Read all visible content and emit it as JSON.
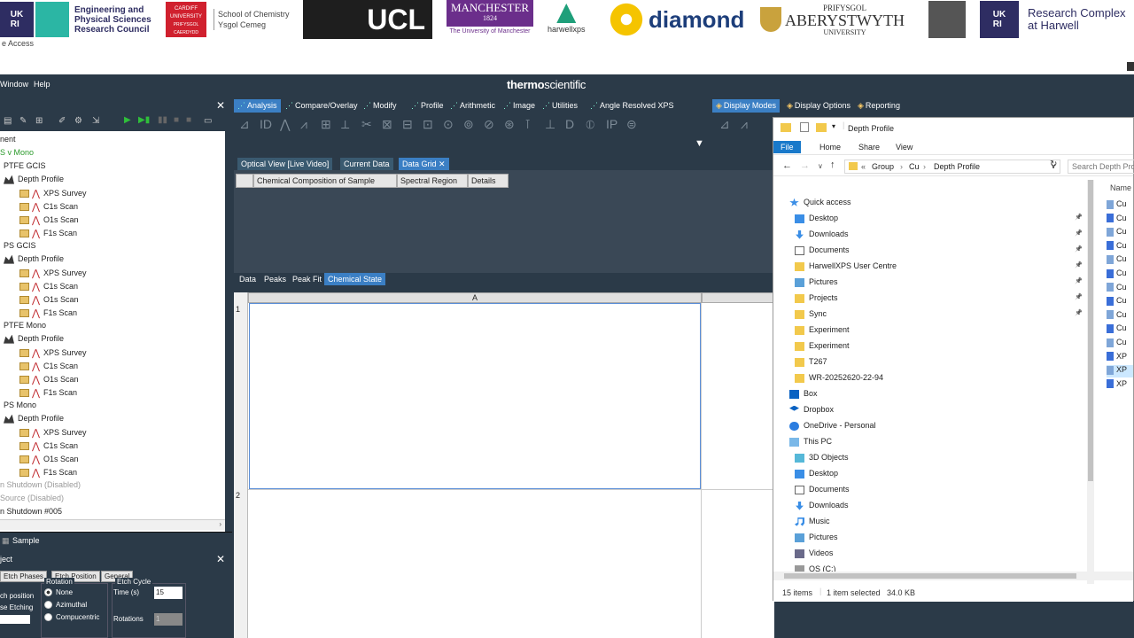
{
  "banner": {
    "epsrc": "Engineering and Physical Sciences Research Council",
    "cardiff_top": "CARDIFF UNIVERSITY",
    "cardiff_bottom": "PRIFYSGOL CAERDYDD",
    "chemistry": "School of Chemistry",
    "chemistry_cy": "Ysgol Cemeg",
    "ucl": "UCL",
    "manchester": "MANCHESTER",
    "manchester_year": "1824",
    "manchester_sub": "The University of Manchester",
    "harwellxps": "harwellxps",
    "diamond": "diamond",
    "aber_top": "PRIFYSGOL",
    "aber_name": "ABERYSTWYTH",
    "aber_bottom": "UNIVERSITY",
    "rch": "Research Complex at Harwell",
    "subtext": "e Access"
  },
  "menubar": {
    "window": "Window",
    "help": "Help"
  },
  "brand": {
    "bold": "thermo",
    "light": "scientific"
  },
  "main_tabs": [
    "Analysis",
    "Compare/Overlay",
    "Modify",
    "Profile",
    "Arithmetic",
    "Image",
    "Utilities",
    "Angle Resolved XPS"
  ],
  "right_tabs": [
    "Display Modes",
    "Display Options",
    "Reporting"
  ],
  "view_tabs": [
    "Optical View [Live Video]",
    "Current Data",
    "Data Grid"
  ],
  "grid_headers": [
    "Chemical Composition of Sample",
    "Spectral Region",
    "Details"
  ],
  "sub_tabs": [
    "Data",
    "Peaks",
    "Peak Fit",
    "Chemical State"
  ],
  "sheet": {
    "col_a": "A",
    "row1": "1",
    "row2": "2"
  },
  "tree": [
    {
      "label": "nent",
      "indent": 0
    },
    {
      "label": "S v Mono",
      "indent": 0,
      "green": true
    },
    {
      "label": "PTFE GCIS",
      "indent": 1
    },
    {
      "label": "Depth Profile",
      "indent": 2,
      "icon": true
    },
    {
      "label": "XPS Survey",
      "indent": 3,
      "scan": true
    },
    {
      "label": "C1s Scan",
      "indent": 3,
      "scan": true
    },
    {
      "label": "O1s Scan",
      "indent": 3,
      "scan": true
    },
    {
      "label": "F1s Scan",
      "indent": 3,
      "scan": true
    },
    {
      "label": "PS GCIS",
      "indent": 1
    },
    {
      "label": "Depth Profile",
      "indent": 2,
      "icon": true
    },
    {
      "label": "XPS Survey",
      "indent": 3,
      "scan": true
    },
    {
      "label": "C1s Scan",
      "indent": 3,
      "scan": true
    },
    {
      "label": "O1s Scan",
      "indent": 3,
      "scan": true
    },
    {
      "label": "F1s Scan",
      "indent": 3,
      "scan": true
    },
    {
      "label": "PTFE Mono",
      "indent": 1
    },
    {
      "label": "Depth Profile",
      "indent": 2,
      "icon": true
    },
    {
      "label": "XPS Survey",
      "indent": 3,
      "scan": true
    },
    {
      "label": "C1s Scan",
      "indent": 3,
      "scan": true
    },
    {
      "label": "O1s Scan",
      "indent": 3,
      "scan": true
    },
    {
      "label": "F1s Scan",
      "indent": 3,
      "scan": true
    },
    {
      "label": "PS Mono",
      "indent": 1
    },
    {
      "label": "Depth Profile",
      "indent": 2,
      "icon": true
    },
    {
      "label": "XPS Survey",
      "indent": 3,
      "scan": true
    },
    {
      "label": "C1s Scan",
      "indent": 3,
      "scan": true
    },
    {
      "label": "O1s Scan",
      "indent": 3,
      "scan": true
    },
    {
      "label": "F1s Scan",
      "indent": 3,
      "scan": true
    },
    {
      "label": "n Shutdown (Disabled)",
      "indent": 0,
      "disabled": true
    },
    {
      "label": "Source (Disabled)",
      "indent": 0,
      "disabled": true
    },
    {
      "label": "n Shutdown #005",
      "indent": 0
    }
  ],
  "sample_panel": {
    "title": "Sample",
    "section": "ject",
    "tabs": [
      "Etch Phases",
      "Etch Position",
      "General"
    ],
    "etch_position": "ch position",
    "etching": "se Etching",
    "rotation_label": "Rotation",
    "rotation_options": [
      "None",
      "Azimuthal",
      "Compucentric"
    ],
    "etch_cycle": "Etch Cycle",
    "time_label": "Time (s)",
    "time_value": "15",
    "rotations_label": "Rotations",
    "rotations_value": "1"
  },
  "explorer": {
    "title": "Depth Profile",
    "ribbon": [
      "File",
      "Home",
      "Share",
      "View"
    ],
    "address": [
      "Group",
      "Cu",
      "Depth Profile"
    ],
    "address_prefix": "«",
    "search_placeholder": "Search Depth Pro",
    "nav": [
      {
        "label": "Quick access",
        "level": 0,
        "icon": "star"
      },
      {
        "label": "Desktop",
        "level": 1,
        "icon": "desktop",
        "pin": true
      },
      {
        "label": "Downloads",
        "level": 1,
        "icon": "download",
        "pin": true
      },
      {
        "label": "Documents",
        "level": 1,
        "icon": "doc",
        "pin": true
      },
      {
        "label": "HarwellXPS User Centre",
        "level": 1,
        "icon": "folder",
        "pin": true
      },
      {
        "label": "Pictures",
        "level": 1,
        "icon": "picture",
        "pin": true
      },
      {
        "label": "Projects",
        "level": 1,
        "icon": "folder",
        "pin": true
      },
      {
        "label": "Sync",
        "level": 1,
        "icon": "folder",
        "pin": true
      },
      {
        "label": "Experiment",
        "level": 1,
        "icon": "folder"
      },
      {
        "label": "Experiment",
        "level": 1,
        "icon": "folder"
      },
      {
        "label": "T267",
        "level": 1,
        "icon": "folder"
      },
      {
        "label": "WR-20252620-22-94",
        "level": 1,
        "icon": "folder"
      },
      {
        "label": "Box",
        "level": 0,
        "icon": "box"
      },
      {
        "label": "Dropbox",
        "level": 0,
        "icon": "dropbox"
      },
      {
        "label": "OneDrive - Personal",
        "level": 0,
        "icon": "cloud"
      },
      {
        "label": "This PC",
        "level": 0,
        "icon": "pc"
      },
      {
        "label": "3D Objects",
        "level": 1,
        "icon": "cube"
      },
      {
        "label": "Desktop",
        "level": 1,
        "icon": "desktop"
      },
      {
        "label": "Documents",
        "level": 1,
        "icon": "doc"
      },
      {
        "label": "Downloads",
        "level": 1,
        "icon": "download"
      },
      {
        "label": "Music",
        "level": 1,
        "icon": "music"
      },
      {
        "label": "Pictures",
        "level": 1,
        "icon": "picture"
      },
      {
        "label": "Videos",
        "level": 1,
        "icon": "video"
      },
      {
        "label": "OS (C:)",
        "level": 1,
        "icon": "drive"
      }
    ],
    "col_name": "Name",
    "files": [
      "Cu",
      "Cu",
      "Cu",
      "Cu",
      "Cu",
      "Cu",
      "Cu",
      "Cu",
      "Cu",
      "Cu",
      "Cu",
      "XP",
      "XP",
      "XP"
    ],
    "status_items": "15 items",
    "status_selected": "1 item selected",
    "status_size": "34.0 KB"
  },
  "colors": {
    "app_bg": "#2b3a48",
    "accent": "#3b7fc4",
    "green": "#2fbf3a",
    "folder": "#f2c94c"
  }
}
